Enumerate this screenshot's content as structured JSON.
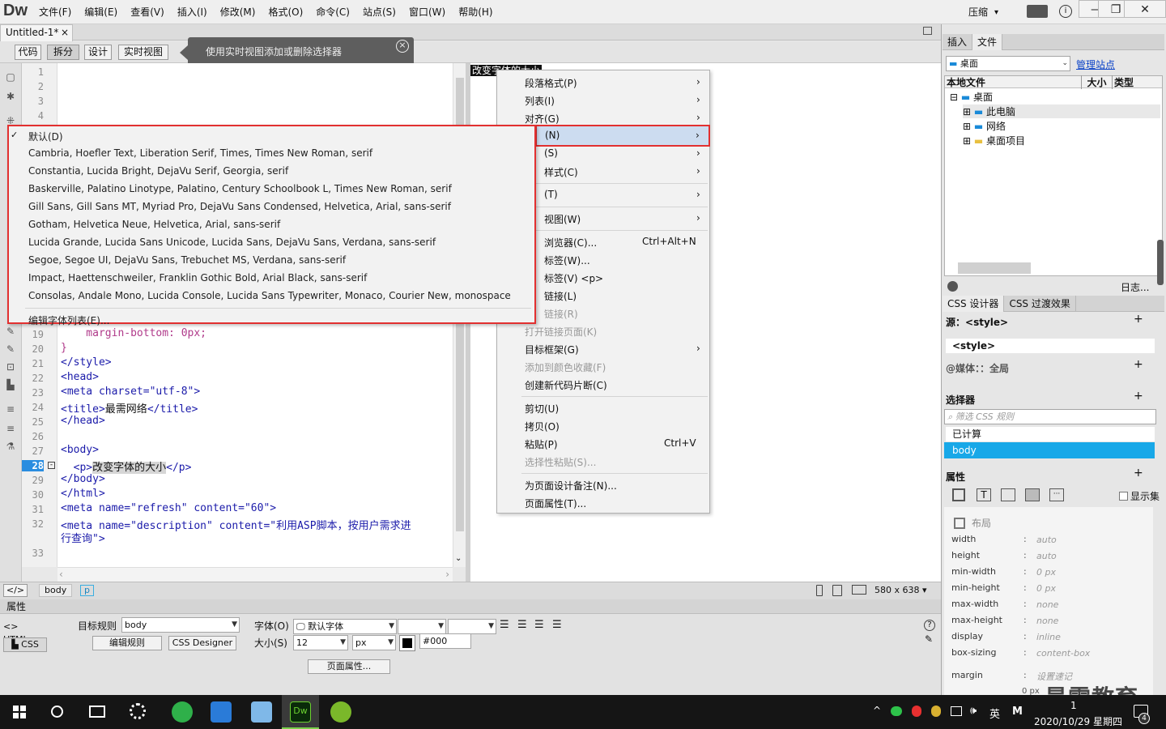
{
  "app": {
    "logo": "Dw",
    "compress": "压缩",
    "compress_arrow": "▾"
  },
  "menus": [
    "文件(F)",
    "编辑(E)",
    "查看(V)",
    "插入(I)",
    "修改(M)",
    "格式(O)",
    "命令(C)",
    "站点(S)",
    "窗口(W)",
    "帮助(H)"
  ],
  "doc_tab": {
    "label": "Untitled-1*",
    "close": "×"
  },
  "view_buttons": [
    "代码",
    "拆分",
    "设计",
    "实时视图"
  ],
  "tooltip": {
    "text": "使用实时视图添加或删除选择器",
    "close": "×"
  },
  "design_selected_text": "改变字体的大小",
  "code_lines": {
    "n1": "1",
    "n2": "2",
    "n3": "3",
    "n4": "4",
    "n19": "19",
    "n20": "20",
    "n21": "21",
    "n22": "22",
    "n23": "23",
    "n24": "24",
    "n25": "25",
    "n26": "26",
    "n27": "27",
    "n28": "28",
    "n29": "29",
    "n30": "30",
    "n31": "31",
    "n32": "32",
    "n33": "33",
    "l19": "    margin-bottom: 0px;",
    "l20": "}",
    "l21": "</style>",
    "l22": "<head>",
    "l23": "<meta charset=\"utf-8\">",
    "l24a": "<title>",
    "l24b": "最需网络",
    "l24c": "</title>",
    "l25": "</head>",
    "l27": "<body>",
    "l28a": "  <p>",
    "l28b": "改变字体的大小",
    "l28c": "</p>",
    "l29": "</body>",
    "l30": "</html>",
    "l31": "<meta name=\"refresh\" content=\"60\">",
    "l32a": "<meta name=\"description\" content=\"利用ASP脚本，按用户需求进",
    "l32b": "行查询\">"
  },
  "font_menu": {
    "items": [
      "默认(D)",
      "Cambria, Hoefler Text, Liberation Serif, Times, Times New Roman, serif",
      "Constantia, Lucida Bright, DejaVu Serif, Georgia, serif",
      "Baskerville, Palatino Linotype, Palatino, Century Schoolbook L, Times New Roman, serif",
      "Gill Sans, Gill Sans MT, Myriad Pro, DejaVu Sans Condensed, Helvetica, Arial, sans-serif",
      "Gotham, Helvetica Neue, Helvetica, Arial, sans-serif",
      "Lucida Grande, Lucida Sans Unicode, Lucida Sans, DejaVu Sans, Verdana, sans-serif",
      "Segoe, Segoe UI, DejaVu Sans, Trebuchet MS, Verdana, sans-serif",
      "Impact, Haettenschweiler, Franklin Gothic Bold, Arial Black, sans-serif",
      "Consolas, Andale Mono, Lucida Console, Lucida Sans Typewriter, Monaco, Courier New, monospace"
    ],
    "edit": "编辑字体列表(E)...",
    "check": "✓"
  },
  "context_menu": {
    "paragraph": "段落格式(P)",
    "list": "列表(I)",
    "align": "对齐(G)",
    "font": "(N)",
    "style": "(S)",
    "css_style": "样式(C)",
    "t": "(T)",
    "view": "视图(W)",
    "browser": "浏览器(C)...",
    "browser_sc": "Ctrl+Alt+N",
    "tag": "标签(W)...",
    "tag2": "标签(V) <p>",
    "link": "链接(L)",
    "link2": "链接(R)",
    "openlink": "打开链接页面(K)",
    "target": "目标框架(G)",
    "addcolor": "添加到颜色收藏(F)",
    "snippet": "创建新代码片断(C)",
    "cut": "剪切(U)",
    "copy": "拷贝(O)",
    "paste": "粘贴(P)",
    "paste_sc": "Ctrl+V",
    "pastesp": "选择性粘贴(S)...",
    "note": "为页面设计备注(N)...",
    "pageprop": "页面属性(T)...",
    "arrow": "›"
  },
  "status": {
    "tag_icon": "</>",
    "body": "body",
    "p": "p",
    "size": "580 x 638 ▾"
  },
  "props": {
    "title": "属性",
    "html": "HTML",
    "css": "CSS",
    "target_rule_label": "目标规则",
    "target_rule": "body",
    "edit_rule": "编辑规则",
    "css_designer": "CSS Designer",
    "font_label": "字体(O)",
    "font_value": "默认字体",
    "size_label": "大小(S)",
    "size_value": "12",
    "unit": "px",
    "color": "#000",
    "page_props": "页面属性..."
  },
  "right": {
    "tabs": [
      "插入",
      "文件"
    ],
    "site": "桌面",
    "manage": "管理站点",
    "cols": [
      "本地文件",
      "大小",
      "类型"
    ],
    "tree": [
      "桌面",
      "此电脑",
      "网络",
      "桌面项目"
    ],
    "log": "日志...",
    "css_tabs": [
      "CSS 设计器",
      "CSS 过渡效果"
    ],
    "source_label": "源：",
    "source_value": "<style>",
    "style_item": "<style>",
    "media_label": "@媒体：：",
    "media_value": "全局",
    "selector": "选择器",
    "filter": "筛选 CSS 规则",
    "computed": "已计算",
    "body": "body",
    "properties": "属性",
    "show_set": "显示集",
    "layout": "布局",
    "css_props": [
      "width",
      "height",
      "min-width",
      "min-height",
      "max-width",
      "max-height",
      "display",
      "box-sizing",
      "margin"
    ],
    "css_vals": [
      "auto",
      "auto",
      "0 px",
      "0 px",
      "none",
      "none",
      "inline",
      "content-box",
      "设置速记"
    ],
    "margin_sub": "0 px"
  },
  "taskbar": {
    "ime": "英",
    "m": "M",
    "time": "1",
    "date": "2020/10/29 星期四",
    "badge": "4"
  },
  "watermark": "最需教育"
}
